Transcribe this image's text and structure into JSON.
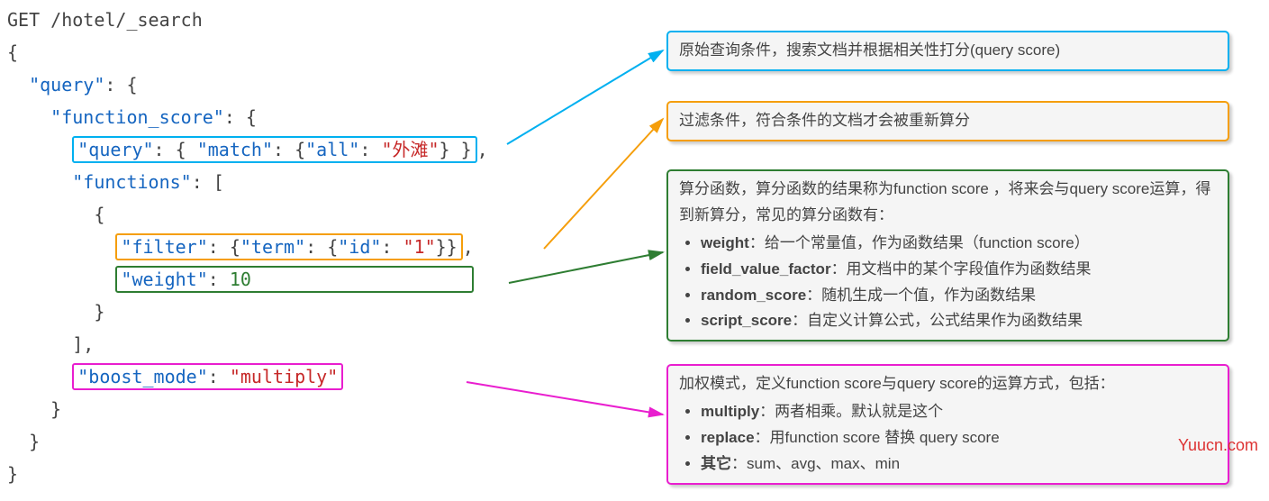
{
  "code": {
    "l0a": "GET",
    "l0b": " /hotel/_search",
    "l1": "{",
    "l2a": "  ",
    "l2key": "\"query\"",
    "l2b": ": {",
    "l3a": "    ",
    "l3key": "\"function_score\"",
    "l3b": ": {",
    "l4a": "      ",
    "l4_query": "\"query\"",
    "l4_mid1": ": { ",
    "l4_match": "\"match\"",
    "l4_mid2": ": {",
    "l4_all": "\"all\"",
    "l4_mid3": ": ",
    "l4_val": "\"外滩\"",
    "l4_end": "} }",
    "l4_comma": ",",
    "l5a": "      ",
    "l5key": "\"functions\"",
    "l5b": ": [",
    "l6": "        {",
    "l7a": "          ",
    "l7_filter": "\"filter\"",
    "l7_mid1": ": {",
    "l7_term": "\"term\"",
    "l7_mid2": ": {",
    "l7_id": "\"id\"",
    "l7_mid3": ": ",
    "l7_val": "\"1\"",
    "l7_end": "}}",
    "l7_comma": ",",
    "l8a": "          ",
    "l8_weight": "\"weight\"",
    "l8_mid": ": ",
    "l8_val": "10",
    "l9": "        }",
    "l10": "      ],",
    "l11a": "      ",
    "l11_boost": "\"boost_mode\"",
    "l11_mid": ": ",
    "l11_val": "\"multiply\"",
    "l12": "    }",
    "l13": "  }",
    "l14": "}"
  },
  "callouts": {
    "blue": "原始查询条件，搜索文档并根据相关性打分(query score)",
    "orange": "过滤条件，符合条件的文档才会被重新算分",
    "green_header": "算分函数，算分函数的结果称为function score ，将来会与query score运算，得到新算分，常见的算分函数有：",
    "green_items": [
      {
        "b": "weight",
        "t": "：给一个常量值，作为函数结果（function score）"
      },
      {
        "b": "field_value_factor",
        "t": "：用文档中的某个字段值作为函数结果"
      },
      {
        "b": "random_score",
        "t": "：随机生成一个值，作为函数结果"
      },
      {
        "b": "script_score",
        "t": "：自定义计算公式，公式结果作为函数结果"
      }
    ],
    "magenta_header": "加权模式，定义function score与query score的运算方式，包括：",
    "magenta_items": [
      {
        "b": "multiply",
        "t": "：两者相乘。默认就是这个"
      },
      {
        "b": "replace",
        "t": "：用function score 替换 query score"
      },
      {
        "b": "其它",
        "t": "：sum、avg、max、min"
      }
    ]
  },
  "watermark": "Yuucn.com"
}
